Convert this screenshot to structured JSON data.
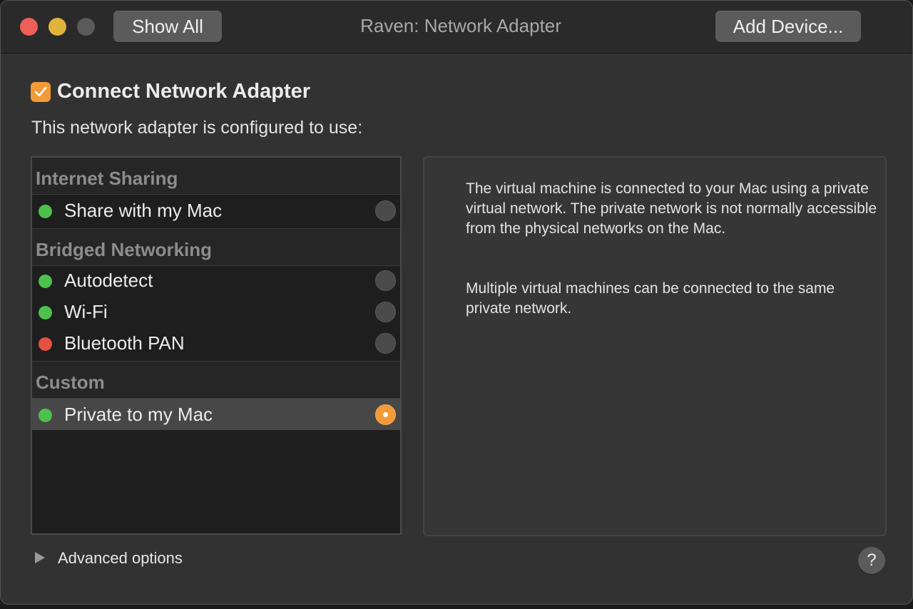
{
  "window": {
    "title": "Raven: Network Adapter",
    "show_all_label": "Show All",
    "add_device_label": "Add Device..."
  },
  "adapter": {
    "connect_label": "Connect Network Adapter",
    "connected": true,
    "config_label": "This network adapter is configured to use:"
  },
  "network_list": {
    "groups": [
      {
        "header": "Internet Sharing",
        "items": [
          {
            "label": "Share with my Mac",
            "status": "green",
            "selected": false
          }
        ]
      },
      {
        "header": "Bridged Networking",
        "items": [
          {
            "label": "Autodetect",
            "status": "green",
            "selected": false
          },
          {
            "label": "Wi-Fi",
            "status": "green",
            "selected": false
          },
          {
            "label": "Bluetooth PAN",
            "status": "red",
            "selected": false
          }
        ]
      },
      {
        "header": "Custom",
        "items": [
          {
            "label": "Private to my Mac",
            "status": "green",
            "selected": true
          }
        ]
      }
    ]
  },
  "description": {
    "paragraph1": "The virtual machine is connected to your Mac using a private virtual network. The private network is not normally accessible from the physical networks on the Mac.",
    "paragraph2": "Multiple virtual machines can be connected to the same private network."
  },
  "footer": {
    "advanced_label": "Advanced options",
    "help_label": "?"
  },
  "colors": {
    "accent": "#f29a38",
    "status_green": "#4cc14d",
    "status_red": "#e5503f"
  }
}
